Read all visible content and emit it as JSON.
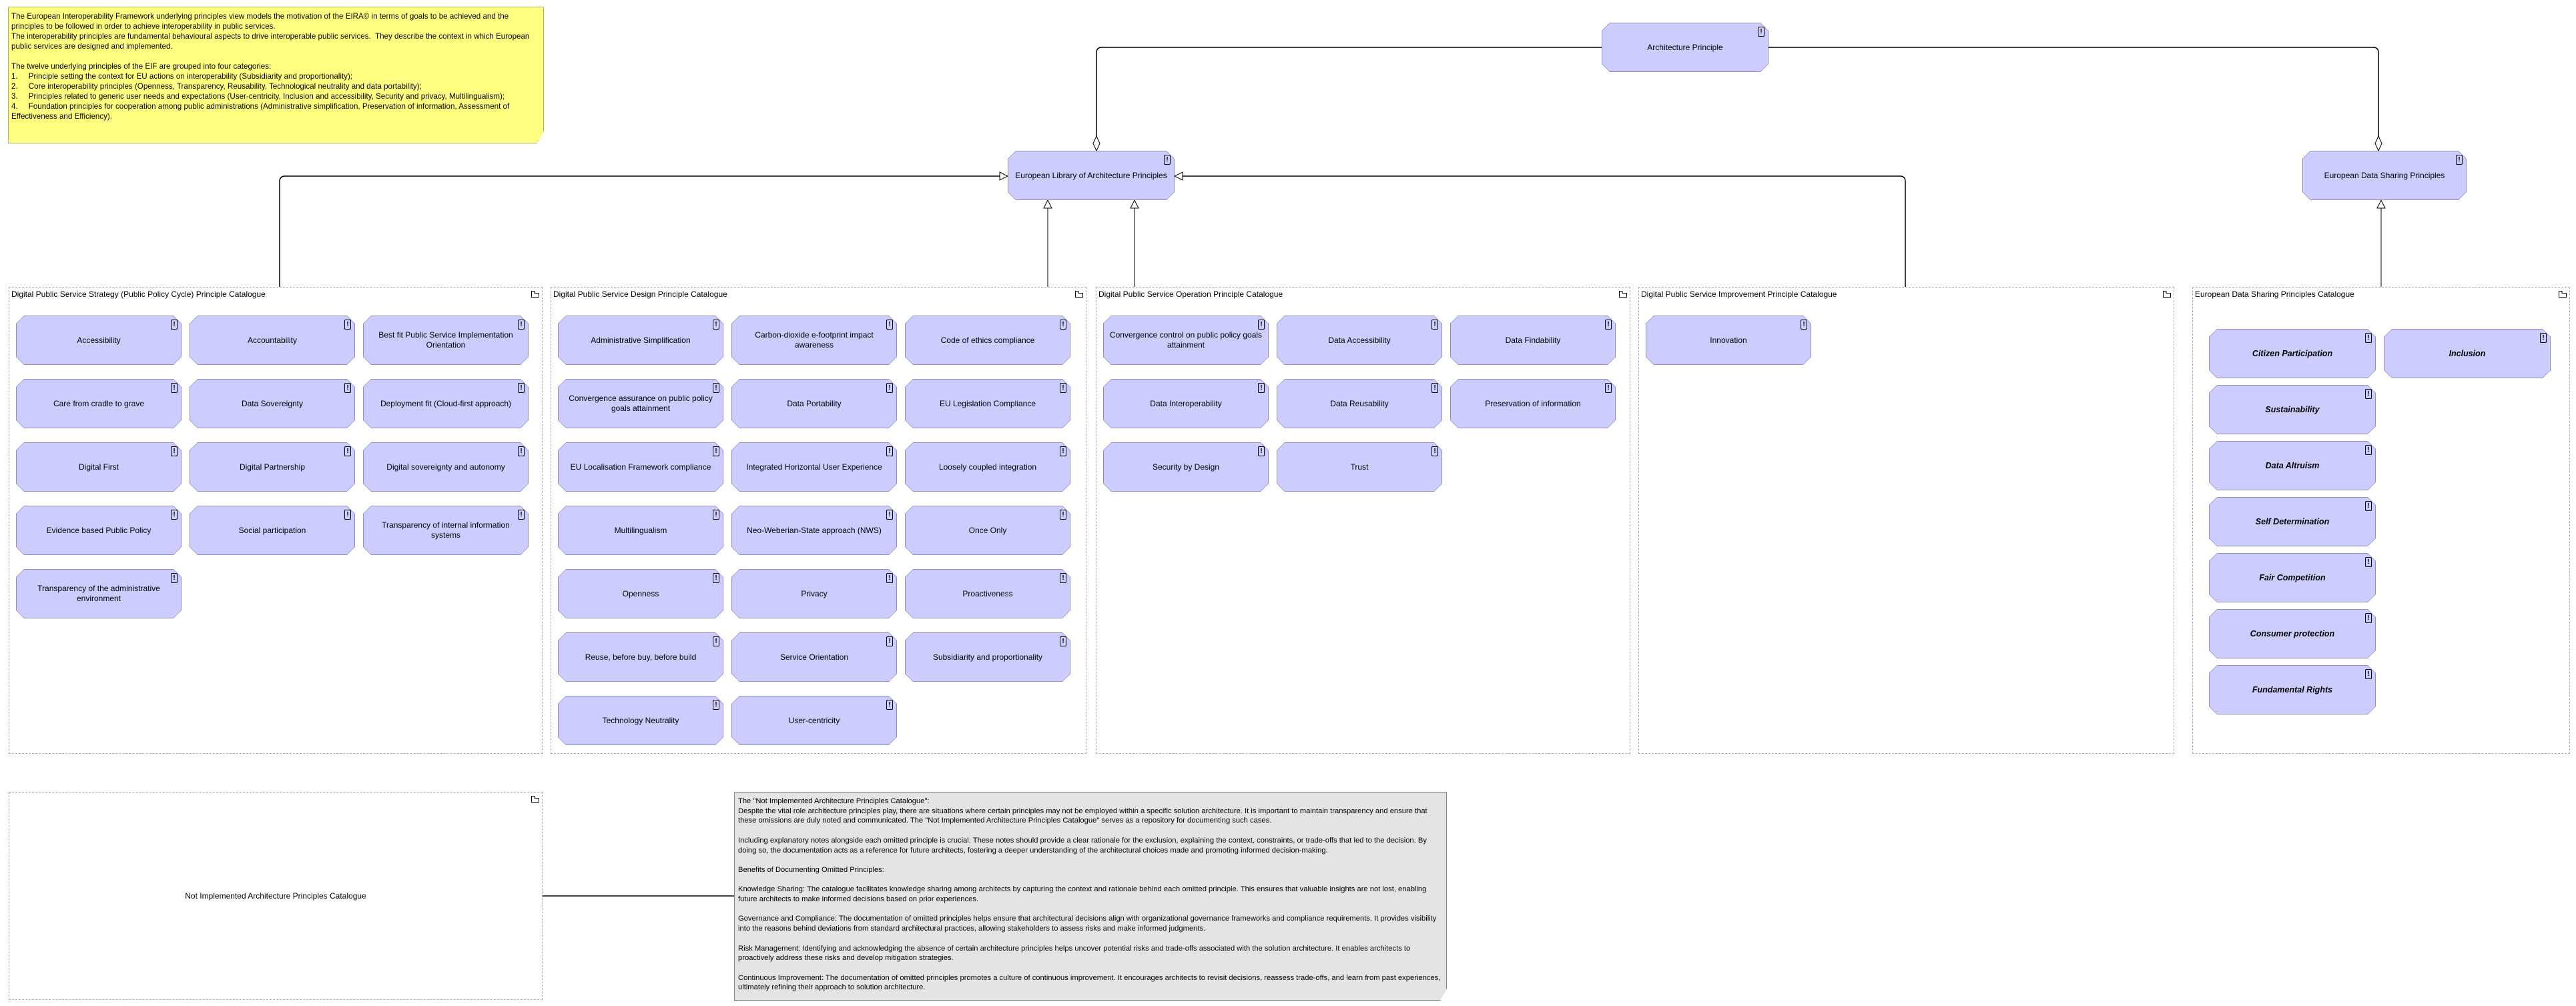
{
  "notes": {
    "eif_note": "The European Interoperability Framework underlying principles view models the motivation of the EIRA© in terms of goals to be achieved and the principles to be followed in order to achieve interoperability in public services.\nThe interoperability principles are fundamental behavioural aspects to drive interoperable public services.  They describe the context in which European public services are designed and implemented.\n\nThe twelve underlying principles of the EIF are grouped into four categories:\n1.\tPrinciple setting the context for EU actions on interoperability (Subsidiarity and proportionality);\n2.\tCore interoperability principles (Openness, Transparency, Reusability, Technological neutrality and data portability);\n3.\tPrinciples related to generic user needs and expectations (User-centricity, Inclusion and accessibility, Security and privacy, Multilingualism);\n4.\tFoundation principles for cooperation among public administrations (Administrative simplification, Preservation of information, Assessment of Effectiveness and Efficiency).",
    "not_implemented_note": "The \"Not Implemented Architecture Principles Catalogue\":\nDespite the vital role architecture principles play, there are situations where certain principles may not be employed within a specific solution architecture. It is important to maintain transparency and ensure that these omissions are duly noted and communicated. The \"Not Implemented Architecture Principles Catalogue\" serves as a repository for documenting such cases.\n\nIncluding explanatory notes alongside each omitted principle is crucial. These notes should provide a clear rationale for the exclusion, explaining the context, constraints, or trade-offs that led to the decision. By doing so, the documentation acts as a reference for future architects, fostering a deeper understanding of the architectural choices made and promoting informed decision-making.\n\nBenefits of Documenting Omitted Principles:\n\nKnowledge Sharing: The catalogue facilitates knowledge sharing among architects by capturing the context and rationale behind each omitted principle. This ensures that valuable insights are not lost, enabling future architects to make informed decisions based on prior experiences.\n\nGovernance and Compliance: The documentation of omitted principles helps ensure that architectural decisions align with organizational governance frameworks and compliance requirements. It provides visibility into the reasons behind deviations from standard architectural practices, allowing stakeholders to assess risks and make informed judgments.\n\nRisk Management: Identifying and acknowledging the absence of certain architecture principles helps uncover potential risks and trade-offs associated with the solution architecture. It enables architects to proactively address these risks and develop mitigation strategies.\n\nContinuous Improvement: The documentation of omitted principles promotes a culture of continuous improvement. It encourages architects to revisit decisions, reassess trade-offs, and learn from past experiences, ultimately refining their approach to solution architecture."
  },
  "top_elements": {
    "architecture_principle": "Architecture Principle",
    "european_library": "European Library of Architecture Principles",
    "european_data_sharing": "European Data Sharing Principles"
  },
  "containers": [
    {
      "title": "Digital Public Service Strategy (Public Policy Cycle) Principle Catalogue",
      "items": [
        "Accessibility",
        "Accountability",
        "Best fit Public Service Implementation Orientation",
        "Care from cradle to grave",
        "Data Sovereignty",
        "Deployment fit (Cloud-first approach)",
        "Digital First",
        "Digital Partnership",
        "Digital sovereignty and autonomy",
        "Evidence based Public Policy",
        "Social participation",
        "Transparency of internal information systems",
        "Transparency of the administrative environment"
      ]
    },
    {
      "title": "Digital Public Service Design Principle Catalogue",
      "items": [
        "Administrative Simplification",
        "Carbon-dioxide e-footprint impact awareness",
        "Code of ethics compliance",
        "Convergence assurance on public policy goals attainment",
        "Data Portability",
        "EU Legislation Compliance",
        "EU Localisation Framework compliance",
        "Integrated Horizontal User Experience",
        "Loosely coupled integration",
        "Multilingualism",
        "Neo-Weberian-State approach (NWS)",
        "Once Only",
        "Openness",
        "Privacy",
        "Proactiveness",
        "Reuse, before buy, before build",
        "Service Orientation",
        "Subsidiarity and proportionality",
        "Technology Neutrality",
        "User-centricity"
      ]
    },
    {
      "title": "Digital Public Service Operation Principle Catalogue",
      "items": [
        "Convergence control on public policy goals attainment",
        "Data Accessibility",
        "Data Findability",
        "Data Interoperability",
        "Data Reusability",
        "Preservation of information",
        "Security by Design",
        "Trust"
      ]
    },
    {
      "title": "Digital Public Service Improvement Principle Catalogue",
      "items": [
        "Innovation"
      ]
    },
    {
      "title": "European Data Sharing Principles Catalogue",
      "items": [
        "Citizen Participation",
        "Inclusion",
        "Sustainability",
        "Data Altruism",
        "Self Determination",
        "Fair Competition",
        "Consumer protection",
        "Fundamental Rights"
      ]
    }
  ],
  "not_implemented_catalogue": "Not Implemented Architecture Principles Catalogue",
  "icons": {
    "principle": "exclamation-icon",
    "container": "folder-icon"
  },
  "colors": {
    "principle_fill": "#ccccff",
    "principle_border": "#8f8fc4",
    "note_yellow": "#ffff80",
    "note_gray": "#e4e4e4"
  }
}
